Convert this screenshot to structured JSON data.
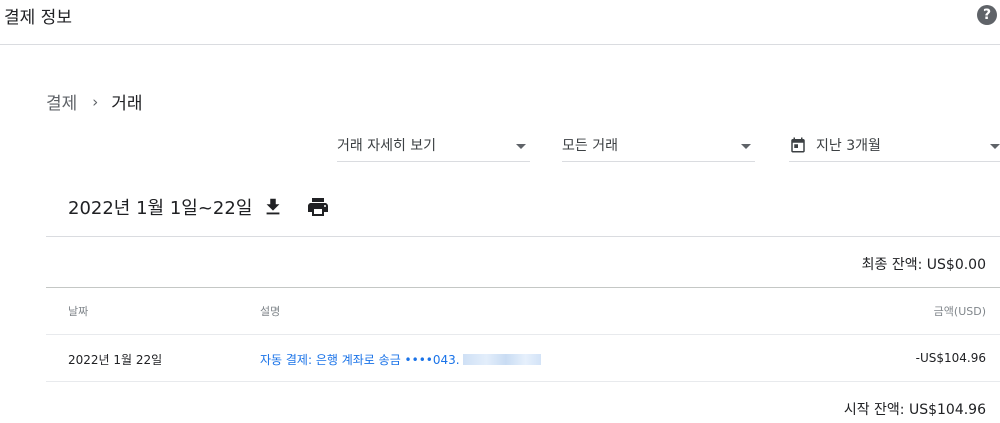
{
  "header": {
    "title": "결제 정보",
    "help_symbol": "?"
  },
  "breadcrumb": {
    "parent": "결제",
    "separator": "›",
    "current": "거래"
  },
  "filters": {
    "view": "거래 자세히 보기",
    "type": "모든 거래",
    "date_range": "지난 3개월"
  },
  "summary": {
    "range_title": "2022년 1월 1일~22일",
    "ending_balance": "최종 잔액: US$0.00",
    "starting_balance": "시작 잔액: US$104.96"
  },
  "table": {
    "columns": {
      "date": "날짜",
      "description": "설명",
      "amount": "금액(USD)"
    },
    "rows": [
      {
        "date": "2022년 1월 22일",
        "description": "자동 결제: 은행 계좌로 송금 ••••043.",
        "amount": "-US$104.96"
      }
    ]
  },
  "colors": {
    "link": "#1a73e8",
    "text": "#202124",
    "muted": "#5f6368",
    "divider": "#dadce0"
  },
  "icons": {
    "help": "help-icon",
    "calendar": "calendar-icon",
    "download": "download-icon",
    "print": "print-icon",
    "dropdown": "caret-down-icon"
  }
}
